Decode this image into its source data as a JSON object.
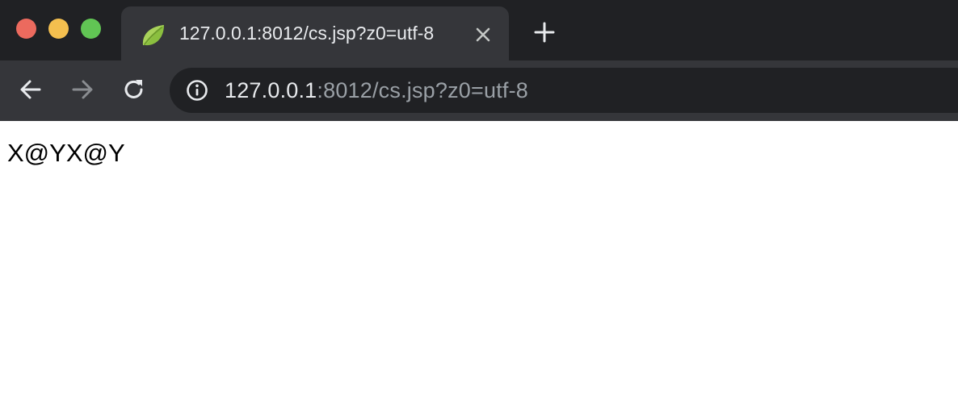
{
  "window": {
    "traffic_lights": {
      "close_color": "#ec6a5e",
      "minimize_color": "#f4bf4f",
      "maximize_color": "#61c554"
    }
  },
  "tab": {
    "title": "127.0.0.1:8012/cs.jsp?z0=utf-8",
    "favicon": "leaf-icon",
    "close_icon": "close-icon"
  },
  "new_tab": {
    "icon": "plus-icon"
  },
  "toolbar": {
    "back_icon": "arrow-left-icon",
    "forward_icon": "arrow-right-icon",
    "reload_icon": "reload-icon"
  },
  "address_bar": {
    "security_icon": "info-icon",
    "host": "127.0.0.1",
    "rest": ":8012/cs.jsp?z0=utf-8"
  },
  "page": {
    "text": "X@YX@Y"
  },
  "colors": {
    "tabstrip_bg": "#202124",
    "toolbar_bg": "#35363a",
    "omnibox_bg": "#202124",
    "text_primary": "#e8eaed",
    "text_secondary": "#9aa0a6"
  }
}
